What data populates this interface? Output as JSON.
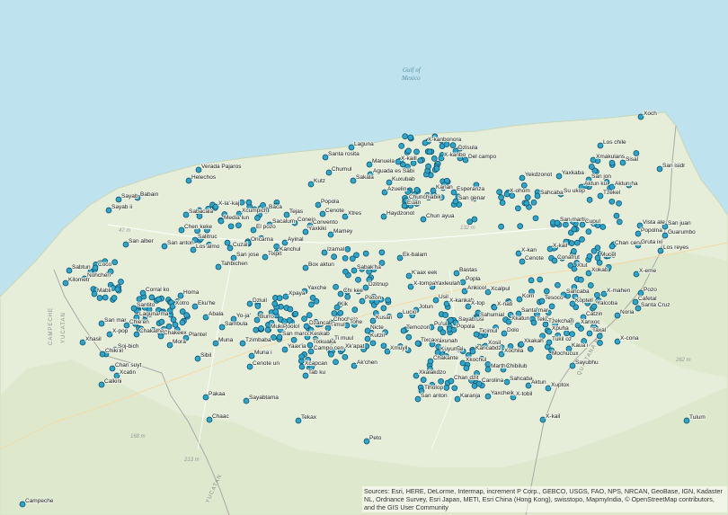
{
  "map": {
    "water_label": [
      "Gulf of",
      "Mexico"
    ],
    "state_labels": [
      "CAMPECHE",
      "YUCATAN",
      "QUINTANA ROO",
      "YUCATAN"
    ],
    "road_labels": [
      "47 m",
      "132 m",
      "168 m",
      "213 m",
      "262 m"
    ],
    "city_labels": [
      "Campeche",
      "Tulum",
      "Xoch",
      "Los chile",
      "San isidr"
    ],
    "colors": {
      "water": "#bfe3ee",
      "land": "#e6eed9",
      "site": "#2fa3c8",
      "site_stroke": "#0a4d66"
    }
  },
  "places": [
    {
      "name": "Xoch"
    },
    {
      "name": "Laguna"
    },
    {
      "name": "X-kanbonora"
    },
    {
      "name": "Dzisula"
    },
    {
      "name": "Santa rosita"
    },
    {
      "name": "Manuela"
    },
    {
      "name": "X-kaill"
    },
    {
      "name": "X-kanbo"
    },
    {
      "name": "Del campo"
    },
    {
      "name": "Los chile"
    },
    {
      "name": "Xmakulans"
    },
    {
      "name": "Sisal"
    },
    {
      "name": "San isidr"
    },
    {
      "name": "Verada Pajaros"
    },
    {
      "name": "Helechos"
    },
    {
      "name": "Chumul"
    },
    {
      "name": "Kutz"
    },
    {
      "name": "Sakala"
    },
    {
      "name": "Aguada es Sabi"
    },
    {
      "name": "Yekdzonot"
    },
    {
      "name": "Yaxkaba"
    },
    {
      "name": "San jon"
    },
    {
      "name": "Aktun ku"
    },
    {
      "name": "Aktun ha"
    },
    {
      "name": "Sayab"
    },
    {
      "name": "Babain"
    },
    {
      "name": "Sayab ii"
    },
    {
      "name": "Kuxubab"
    },
    {
      "name": "Kanan"
    },
    {
      "name": "Esperanza"
    },
    {
      "name": "Azuelin"
    },
    {
      "name": "Chunchiabik"
    },
    {
      "name": "San genar"
    },
    {
      "name": "X-ohom"
    },
    {
      "name": "Sahcaba"
    },
    {
      "name": "Su ukop"
    },
    {
      "name": "Tzekel"
    },
    {
      "name": "X-la'-kaj"
    },
    {
      "name": "Xcumpich"
    },
    {
      "name": "Baca"
    },
    {
      "name": "Popola"
    },
    {
      "name": "Sabacala"
    },
    {
      "name": "Media lun"
    },
    {
      "name": "Tejas"
    },
    {
      "name": "Cenote"
    },
    {
      "name": "Xtres"
    },
    {
      "name": "Euan"
    },
    {
      "name": "Haydzonot"
    },
    {
      "name": "Chun ayua"
    },
    {
      "name": "Sacalum"
    },
    {
      "name": "Conejo"
    },
    {
      "name": "Convento"
    },
    {
      "name": "Chen keke"
    },
    {
      "name": "El pozo"
    },
    {
      "name": "Yaxkiki"
    },
    {
      "name": "Mamey"
    },
    {
      "name": "San martin"
    },
    {
      "name": "Cupul"
    },
    {
      "name": "Vista ale"
    },
    {
      "name": "San juan"
    },
    {
      "name": "Popolna"
    },
    {
      "name": "Guarumbo"
    },
    {
      "name": "San alber"
    },
    {
      "name": "San anton"
    },
    {
      "name": "Salitruc"
    },
    {
      "name": "Oncarna"
    },
    {
      "name": "Ayinal"
    },
    {
      "name": "Los almo"
    },
    {
      "name": "Cuzal"
    },
    {
      "name": "Kanchul"
    },
    {
      "name": "Izamal"
    },
    {
      "name": "Chan ceno"
    },
    {
      "name": "Gruta ixi"
    },
    {
      "name": "Los reyes"
    },
    {
      "name": "San jose"
    },
    {
      "name": "Tixpit"
    },
    {
      "name": "Tahbichen"
    },
    {
      "name": "Box aktun"
    },
    {
      "name": "Ek-balam"
    },
    {
      "name": "X-kan"
    },
    {
      "name": "X-kail"
    },
    {
      "name": "Cenote"
    },
    {
      "name": "Conafrut"
    },
    {
      "name": "Xtut"
    },
    {
      "name": "Sabtun"
    },
    {
      "name": "Coco"
    },
    {
      "name": "Nohchen"
    },
    {
      "name": "Kilometr"
    },
    {
      "name": "Sabak'ha"
    },
    {
      "name": "K'aax eek"
    },
    {
      "name": "Bastas"
    },
    {
      "name": "Popla"
    },
    {
      "name": "Chi kee"
    },
    {
      "name": "Dzitnup"
    },
    {
      "name": "Mucel"
    },
    {
      "name": "Xokab"
    },
    {
      "name": "X-eme"
    },
    {
      "name": "Mabli"
    },
    {
      "name": "Corral ko"
    },
    {
      "name": "Yaxche"
    },
    {
      "name": "Pixton"
    },
    {
      "name": "Kik"
    },
    {
      "name": "X-tompa"
    },
    {
      "name": "Yaxleulah"
    },
    {
      "name": "Ankicol"
    },
    {
      "name": "Xcalpul"
    },
    {
      "name": "Sahcaba"
    },
    {
      "name": "X-mahen"
    },
    {
      "name": "Pozo"
    },
    {
      "name": "Homa"
    },
    {
      "name": "Xotro"
    },
    {
      "name": "Eku'he"
    },
    {
      "name": "Dziuil"
    },
    {
      "name": "Xpaya"
    },
    {
      "name": "Usil"
    },
    {
      "name": "X-kankah"
    },
    {
      "name": "Jotun"
    },
    {
      "name": "X-top"
    },
    {
      "name": "X-nab"
    },
    {
      "name": "Kom"
    },
    {
      "name": "Tesoco"
    },
    {
      "name": "Koptell"
    },
    {
      "name": "Yalcoba"
    },
    {
      "name": "Cafetal"
    },
    {
      "name": "Santa Cruz"
    },
    {
      "name": "Laguna ma"
    },
    {
      "name": "Santito"
    },
    {
      "name": "Abala"
    },
    {
      "name": "Yo-ja'"
    },
    {
      "name": "Burro"
    },
    {
      "name": "Lucio"
    },
    {
      "name": "Sahumial"
    },
    {
      "name": "Santa mar"
    },
    {
      "name": "Catzin"
    },
    {
      "name": "Noria"
    },
    {
      "name": "San mar"
    },
    {
      "name": "Chie'en"
    },
    {
      "name": "Sambula"
    },
    {
      "name": "Mukuyche"
    },
    {
      "name": "Timul"
    },
    {
      "name": "Chochola"
    },
    {
      "name": "Tohe"
    },
    {
      "name": "Kusan"
    },
    {
      "name": "Sayab usi"
    },
    {
      "name": "Xkatun"
    },
    {
      "name": "Tekom"
    },
    {
      "name": "Tzekchan"
    },
    {
      "name": "Xpuha"
    },
    {
      "name": "Xanxoc"
    },
    {
      "name": "X-pop"
    },
    {
      "name": "Chakalhau"
    },
    {
      "name": "Chakeex"
    },
    {
      "name": "Plantel"
    },
    {
      "name": "Tzimbaba"
    },
    {
      "name": "Poolol"
    },
    {
      "name": "Dzancab"
    },
    {
      "name": "Nicte"
    },
    {
      "name": "Temozon"
    },
    {
      "name": "Pu'ul"
    },
    {
      "name": "Popola"
    },
    {
      "name": "Ticimul"
    },
    {
      "name": "Dolo"
    },
    {
      "name": "Taxal"
    },
    {
      "name": "X-cona"
    },
    {
      "name": "Xhasil"
    },
    {
      "name": "Soj-bich"
    },
    {
      "name": "Mora"
    },
    {
      "name": "Muna"
    },
    {
      "name": "San marco"
    },
    {
      "name": "Keskab"
    },
    {
      "name": "Tixkuaka"
    },
    {
      "name": "Ti muul"
    },
    {
      "name": "Kutzil"
    },
    {
      "name": "Tixcacal"
    },
    {
      "name": "Yaxunah"
    },
    {
      "name": "Xosil"
    },
    {
      "name": "Xkakah"
    },
    {
      "name": "Tukil oz"
    },
    {
      "name": "Kaua i"
    },
    {
      "name": "Dzibil"
    },
    {
      "name": "Sibil"
    },
    {
      "name": "Muna i"
    },
    {
      "name": "Yaax'ia"
    },
    {
      "name": "Xk'apat"
    },
    {
      "name": "Xmuyil"
    },
    {
      "name": "Kuyumal"
    },
    {
      "name": "Kancabdz"
    },
    {
      "name": "Xochila"
    },
    {
      "name": "Sayubhu"
    },
    {
      "name": "Mochucux"
    },
    {
      "name": "Chan suyt"
    },
    {
      "name": "Xcatin"
    },
    {
      "name": "Cenote un"
    },
    {
      "name": "Campo cen"
    },
    {
      "name": "Ak'chen"
    },
    {
      "name": "Chakante"
    },
    {
      "name": "Marthaca"
    },
    {
      "name": "Xkochul"
    },
    {
      "name": "Chibilub"
    },
    {
      "name": "Xcapcan"
    },
    {
      "name": "Chiki"
    },
    {
      "name": "Calkini"
    },
    {
      "name": "Tab ku"
    },
    {
      "name": "Xkalakdzo"
    },
    {
      "name": "Chan dzit"
    },
    {
      "name": "Carolina"
    },
    {
      "name": "Sahcaba"
    },
    {
      "name": "Aktun"
    },
    {
      "name": "Xuptox"
    },
    {
      "name": "Tiholop"
    },
    {
      "name": "Yaxcheik"
    },
    {
      "name": "X-tobil"
    },
    {
      "name": "Pakaa"
    },
    {
      "name": "Sayabtama"
    },
    {
      "name": "San anton"
    },
    {
      "name": "Karanja"
    },
    {
      "name": "X-kail"
    },
    {
      "name": "Chaac"
    },
    {
      "name": "Tekax"
    },
    {
      "name": "Peto"
    },
    {
      "name": "Campeche"
    },
    {
      "name": "Tulum"
    }
  ],
  "attribution": "Sources: Esri, HERE, DeLorme, Intermap, increment P Corp., GEBCO, USGS, FAO, NPS, NRCAN, GeoBase, IGN, Kadaster NL, Ordnance Survey, Esri Japan, METI, Esri China (Hong Kong), swisstopo, MapmyIndia, © OpenStreetMap contributors, and the GIS User Community"
}
